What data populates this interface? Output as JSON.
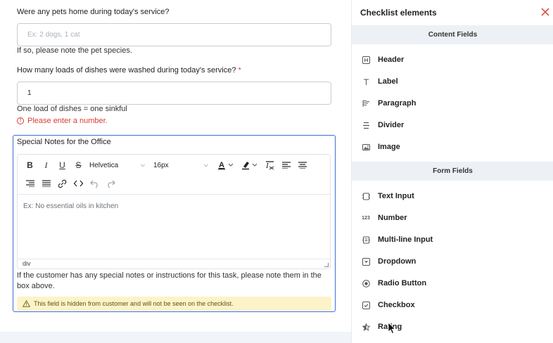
{
  "form": {
    "q1": {
      "label": "Were any pets home during today's service?",
      "placeholder": "Ex: 2 dogs, 1 cat",
      "help": "If so, please note the pet species."
    },
    "q2": {
      "label": "How many loads of dishes were washed during today's service?",
      "required_mark": "*",
      "value": "1",
      "help": "One load of dishes = one sinkful",
      "error": "Please enter a number.",
      "error_icon": "!"
    },
    "q3": {
      "label": "Special Notes for the Office",
      "font_family": "Helvetica",
      "font_size": "16px",
      "placeholder": "Ex: No essential oils in kitchen",
      "status": "div",
      "help": "If the customer has any special notes or instructions for this task, please note them in the box above.",
      "warning": "This field is hidden from customer and will not be seen on the checklist."
    }
  },
  "toolbar": {
    "bold": "B",
    "italic": "I",
    "underline": "U",
    "strike": "S",
    "text_color_letter": "A",
    "clear_format": "Ix"
  },
  "panel": {
    "title": "Checklist elements",
    "content_section": "Content Fields",
    "content_items": [
      {
        "label": "Header",
        "icon": "header-icon"
      },
      {
        "label": "Label",
        "icon": "text-icon"
      },
      {
        "label": "Paragraph",
        "icon": "paragraph-icon"
      },
      {
        "label": "Divider",
        "icon": "divider-icon"
      },
      {
        "label": "Image",
        "icon": "image-icon"
      }
    ],
    "form_section": "Form Fields",
    "form_items": [
      {
        "label": "Text Input",
        "icon": "text-input-icon"
      },
      {
        "label": "Number",
        "icon": "number-icon",
        "glyph": "123"
      },
      {
        "label": "Multi-line Input",
        "icon": "multiline-icon"
      },
      {
        "label": "Dropdown",
        "icon": "dropdown-icon"
      },
      {
        "label": "Radio Button",
        "icon": "radio-icon"
      },
      {
        "label": "Checkbox",
        "icon": "checkbox-icon"
      },
      {
        "label": "Rating",
        "icon": "star-icon"
      }
    ]
  },
  "colors": {
    "accent": "#3b6fd8",
    "error": "#d93b30",
    "warning_bg": "#fcf3c9",
    "close": "#e0524a",
    "section_bg": "#edf1f5"
  }
}
